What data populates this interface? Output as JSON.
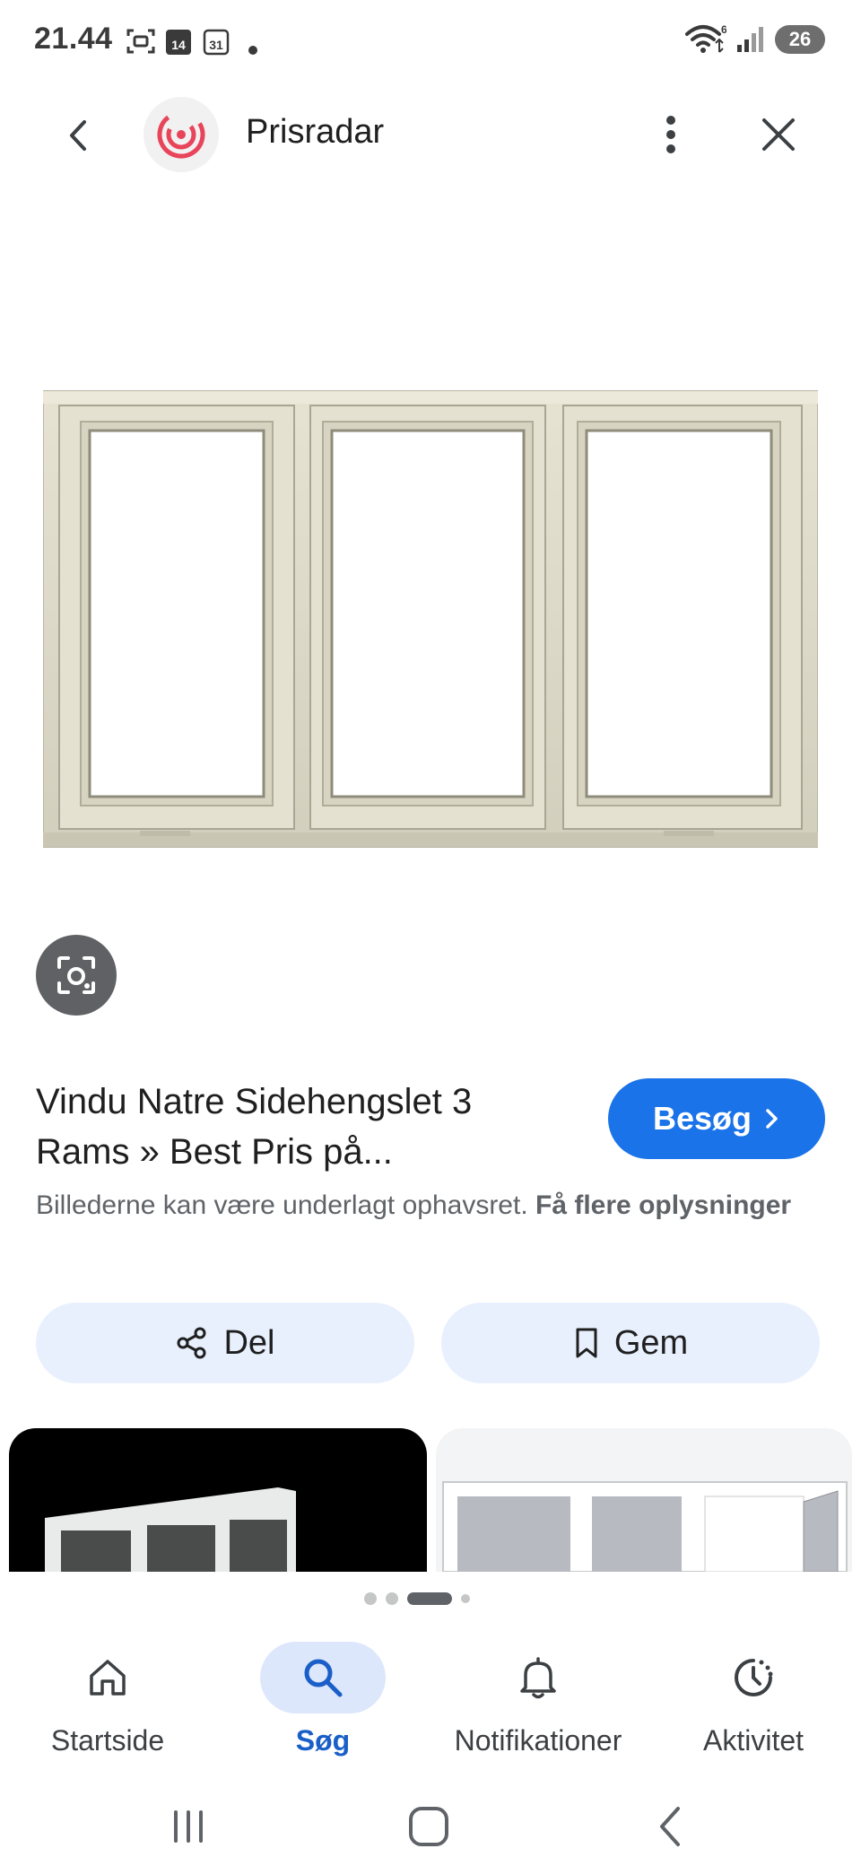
{
  "status_bar": {
    "time": "21.44",
    "calendar_day_1": "14",
    "calendar_day_2": "31",
    "battery": "26"
  },
  "app_bar": {
    "title": "Prisradar"
  },
  "result": {
    "title": "Vindu Natre Sidehengslet 3 Rams » Best Pris på...",
    "visit_label": "Besøg",
    "copyright_text": "Billederne kan være underlagt ophavsret.",
    "more_info_link": "Få flere oplysninger"
  },
  "actions": {
    "share_label": "Del",
    "save_label": "Gem"
  },
  "bottom_nav": {
    "items": [
      {
        "label": "Startside",
        "icon": "home-icon"
      },
      {
        "label": "Søg",
        "icon": "search-icon",
        "active": true
      },
      {
        "label": "Notifikationer",
        "icon": "bell-icon"
      },
      {
        "label": "Aktivitet",
        "icon": "activity-icon"
      }
    ]
  },
  "colors": {
    "accent": "#1a73e8",
    "pill_bg": "#e8f0fe",
    "window_frame": "#ddd9c6"
  }
}
